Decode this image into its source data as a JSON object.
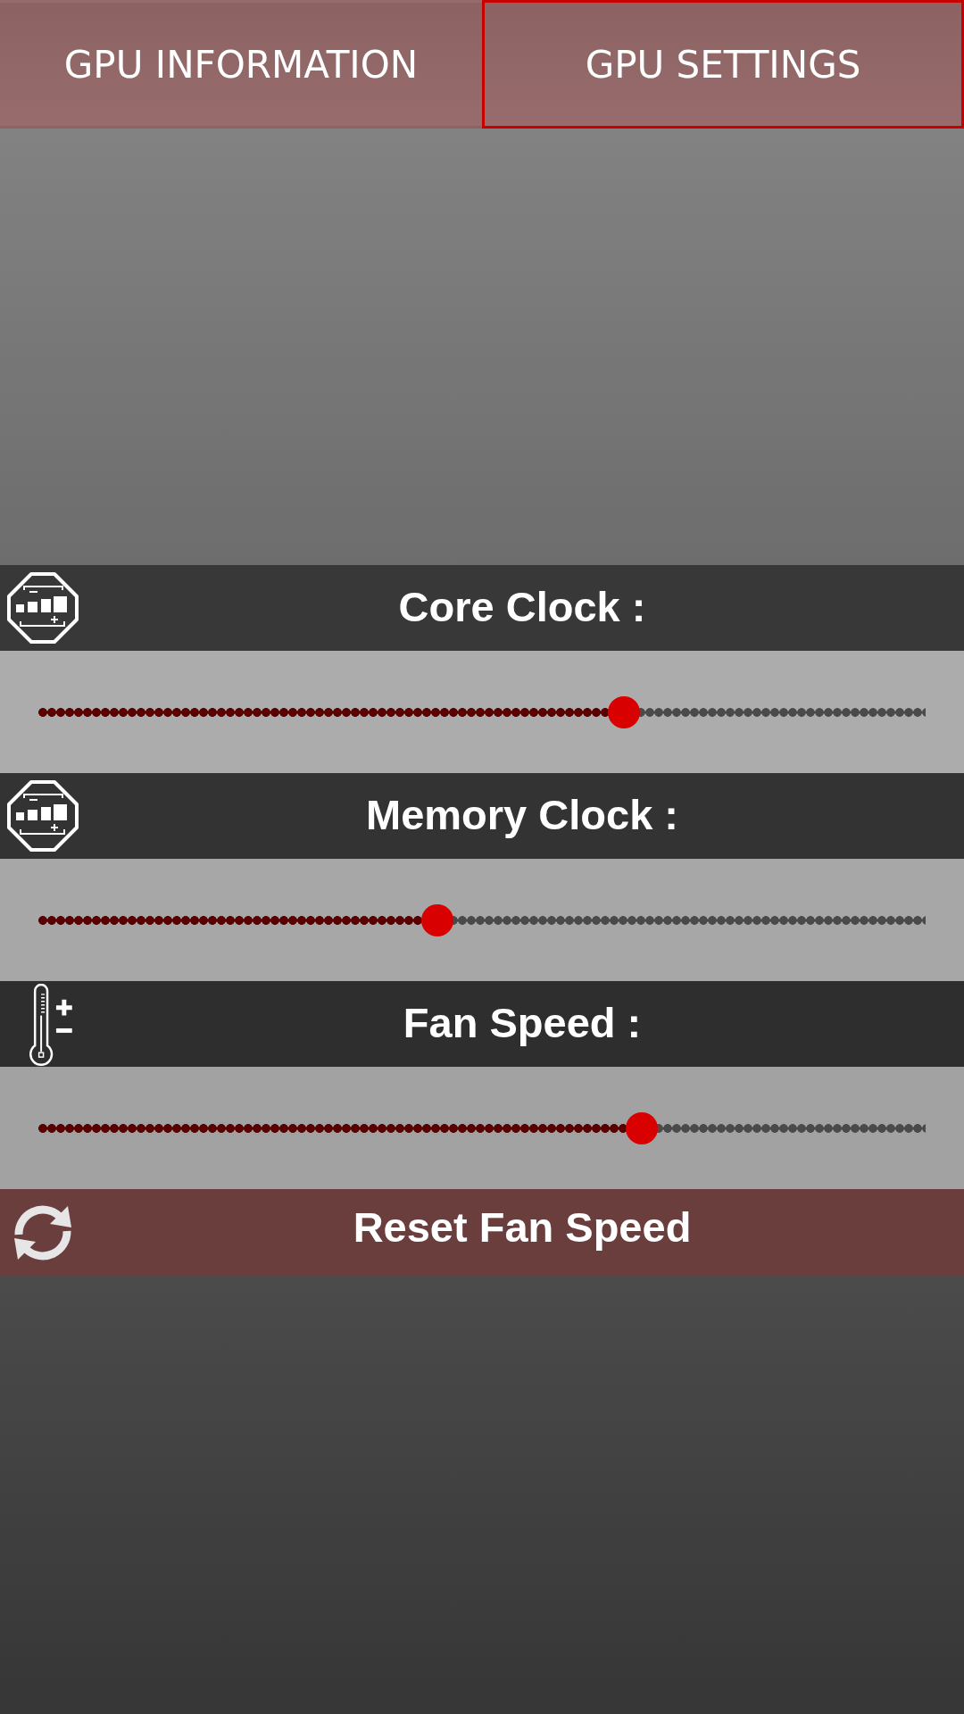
{
  "tabs": [
    {
      "label": "GPU INFORMATION",
      "selected": false
    },
    {
      "label": "GPU SETTINGS",
      "selected": true
    }
  ],
  "sliders": [
    {
      "kind": "clock",
      "label": "Core Clock :",
      "level": 0.66
    },
    {
      "kind": "clock",
      "label": "Memory Clock :",
      "level": 0.45
    },
    {
      "kind": "fan",
      "label": "Fan Speed :",
      "level": 0.68
    }
  ],
  "reset_button": {
    "label": "Reset Fan Speed"
  }
}
